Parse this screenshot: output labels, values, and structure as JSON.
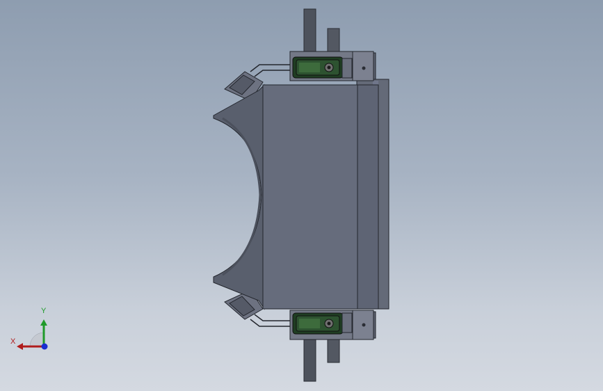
{
  "viewport": {
    "background_top": "#8e9db0",
    "background_bottom": "#d4d9e1"
  },
  "model": {
    "body_color": "#5e6474",
    "body_front_color": "#666c7c",
    "flange_color": "#595f6d",
    "roller_color": "#646a78",
    "edge_color": "#23262d",
    "bracket_color": "#747987",
    "rod_color": "#4d525c",
    "actuator_color": "#1f3d22",
    "actuator_highlight": "#3d6b3c"
  },
  "triad": {
    "y_label": "Y",
    "x_label": "X",
    "y_color": "#1f9a2a",
    "x_color": "#b01c1c",
    "z_color": "#1a2ed0"
  }
}
